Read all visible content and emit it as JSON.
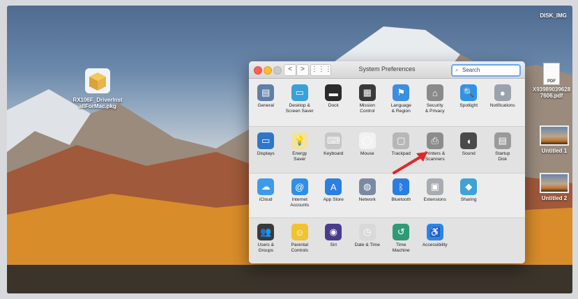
{
  "desktop": {
    "disk_label": "DISK_IMG",
    "pkg_name": "RX106F_DriverInstallForMac.pkg",
    "pkg_line1": "RX106F_DriverInst",
    "pkg_line2": "allForMac.pkg",
    "pdf_badge": "PDF",
    "pdf_line1": "X93989039628",
    "pdf_line2": "7606.pdf",
    "untitled1": "Untitled 1",
    "untitled2": "Untitled 2"
  },
  "window": {
    "title": "System Preferences",
    "search_placeholder": "Search",
    "nav_back": "<",
    "nav_fwd": ">",
    "nav_grid": "⋮⋮⋮"
  },
  "sections": [
    [
      {
        "label": "General",
        "icon": "general-icon",
        "color": "#5f7fa8"
      },
      {
        "label": "Desktop &\nScreen Saver",
        "icon": "desktop-screensaver-icon",
        "color": "#3aa0d8"
      },
      {
        "label": "Dock",
        "icon": "dock-icon",
        "color": "#2b2b2b"
      },
      {
        "label": "Mission\nControl",
        "icon": "mission-control-icon",
        "color": "#3a3a3a"
      },
      {
        "label": "Language\n& Region",
        "icon": "language-region-icon",
        "color": "#3b8ee0"
      },
      {
        "label": "Security\n& Privacy",
        "icon": "security-privacy-icon",
        "color": "#8a8a8a"
      },
      {
        "label": "Spotlight",
        "icon": "spotlight-icon",
        "color": "#2e93e8"
      },
      {
        "label": "Notifications",
        "icon": "notifications-icon",
        "color": "#9aa3ad"
      }
    ],
    [
      {
        "label": "Displays",
        "icon": "displays-icon",
        "color": "#2f76c8"
      },
      {
        "label": "Energy\nSaver",
        "icon": "energy-saver-icon",
        "color": "#f1e3a0"
      },
      {
        "label": "Keyboard",
        "icon": "keyboard-icon",
        "color": "#c7c7c7"
      },
      {
        "label": "Mouse",
        "icon": "mouse-icon",
        "color": "#f2f2f2"
      },
      {
        "label": "Trackpad",
        "icon": "trackpad-icon",
        "color": "#b7b7b7"
      },
      {
        "label": "Printers &\nScanners",
        "icon": "printers-scanners-icon",
        "color": "#8c8c8c"
      },
      {
        "label": "Sound",
        "icon": "sound-icon",
        "color": "#4a4a4a"
      },
      {
        "label": "Startup\nDisk",
        "icon": "startup-disk-icon",
        "color": "#9a9a9a"
      }
    ],
    [
      {
        "label": "iCloud",
        "icon": "icloud-icon",
        "color": "#3d9be9"
      },
      {
        "label": "Internet\nAccounts",
        "icon": "internet-accounts-icon",
        "color": "#2f8fe6"
      },
      {
        "label": "App Store",
        "icon": "app-store-icon",
        "color": "#2a7fe0"
      },
      {
        "label": "Network",
        "icon": "network-icon",
        "color": "#7b8aa3"
      },
      {
        "label": "Bluetooth",
        "icon": "bluetooth-icon",
        "color": "#2a7de0"
      },
      {
        "label": "Extensions",
        "icon": "extensions-icon",
        "color": "#a8acb2"
      },
      {
        "label": "Sharing",
        "icon": "sharing-icon",
        "color": "#3ea2d8"
      }
    ],
    [
      {
        "label": "Users &\nGroups",
        "icon": "users-groups-icon",
        "color": "#3a3a3a"
      },
      {
        "label": "Parental\nControls",
        "icon": "parental-controls-icon",
        "color": "#f0c431"
      },
      {
        "label": "Siri",
        "icon": "siri-icon",
        "color": "#4a3b8c"
      },
      {
        "label": "Date & Time",
        "icon": "date-time-icon",
        "color": "#d9d9d9"
      },
      {
        "label": "Time\nMachine",
        "icon": "time-machine-icon",
        "color": "#2f9b76"
      },
      {
        "label": "Accessibility",
        "icon": "accessibility-icon",
        "color": "#2d86e0"
      }
    ]
  ],
  "glyphs": {
    "general-icon": "▤",
    "desktop-screensaver-icon": "▭",
    "dock-icon": "▬",
    "mission-control-icon": "▦",
    "language-region-icon": "⚑",
    "security-privacy-icon": "⌂",
    "spotlight-icon": "🔍",
    "notifications-icon": "●",
    "displays-icon": "▭",
    "energy-saver-icon": "💡",
    "keyboard-icon": "⌨",
    "mouse-icon": "◯",
    "trackpad-icon": "▢",
    "printers-scanners-icon": "⎙",
    "sound-icon": "◖",
    "startup-disk-icon": "▤",
    "icloud-icon": "☁",
    "internet-accounts-icon": "@",
    "app-store-icon": "A",
    "network-icon": "◍",
    "bluetooth-icon": "ᛒ",
    "extensions-icon": "▣",
    "sharing-icon": "◆",
    "users-groups-icon": "👥",
    "parental-controls-icon": "☺",
    "siri-icon": "◉",
    "date-time-icon": "◷",
    "time-machine-icon": "↺",
    "accessibility-icon": "♿"
  }
}
